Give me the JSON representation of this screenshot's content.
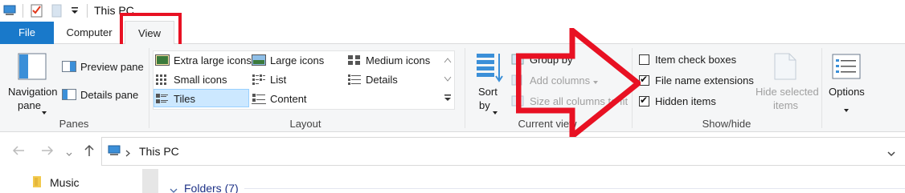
{
  "titlebar": {
    "title": "This PC",
    "icons": [
      "properties-check-icon",
      "new-folder-icon",
      "customize-qat-icon"
    ]
  },
  "tabs": [
    {
      "label": "File"
    },
    {
      "label": "Computer"
    },
    {
      "label": "View"
    }
  ],
  "ribbon": {
    "panes": {
      "navigation_pane_label_1": "Navigation",
      "navigation_pane_label_2": "pane",
      "preview_pane": "Preview pane",
      "details_pane": "Details pane",
      "group_label": "Panes"
    },
    "layout": {
      "items": [
        {
          "label": "Extra large icons"
        },
        {
          "label": "Large icons"
        },
        {
          "label": "Medium icons"
        },
        {
          "label": "Small icons"
        },
        {
          "label": "List"
        },
        {
          "label": "Details"
        },
        {
          "label": "Tiles"
        },
        {
          "label": "Content"
        }
      ],
      "selected": "Tiles",
      "group_label": "Layout"
    },
    "current_view": {
      "sort_by_1": "Sort",
      "sort_by_2": "by",
      "group_by": "Group by",
      "add_columns": "Add columns",
      "size_columns": "Size all columns to fit",
      "group_label": "Current view"
    },
    "show_hide": {
      "item_check_boxes": {
        "label": "Item check boxes",
        "checked": false
      },
      "file_name_extensions": {
        "label": "File name extensions",
        "checked": true
      },
      "hidden_items": {
        "label": "Hidden items",
        "checked": true
      },
      "hide_selected_1": "Hide selected",
      "hide_selected_2": "items",
      "group_label": "Show/hide"
    },
    "options": {
      "label": "Options"
    }
  },
  "address": {
    "path": "This PC"
  },
  "nav_pane": {
    "items": [
      {
        "label": "Music"
      }
    ]
  },
  "content": {
    "section": "Folders (7)"
  },
  "colors": {
    "file_tab": "#1979ca",
    "highlight": "#e81123",
    "ribbon_bg": "#f5f6f7"
  }
}
